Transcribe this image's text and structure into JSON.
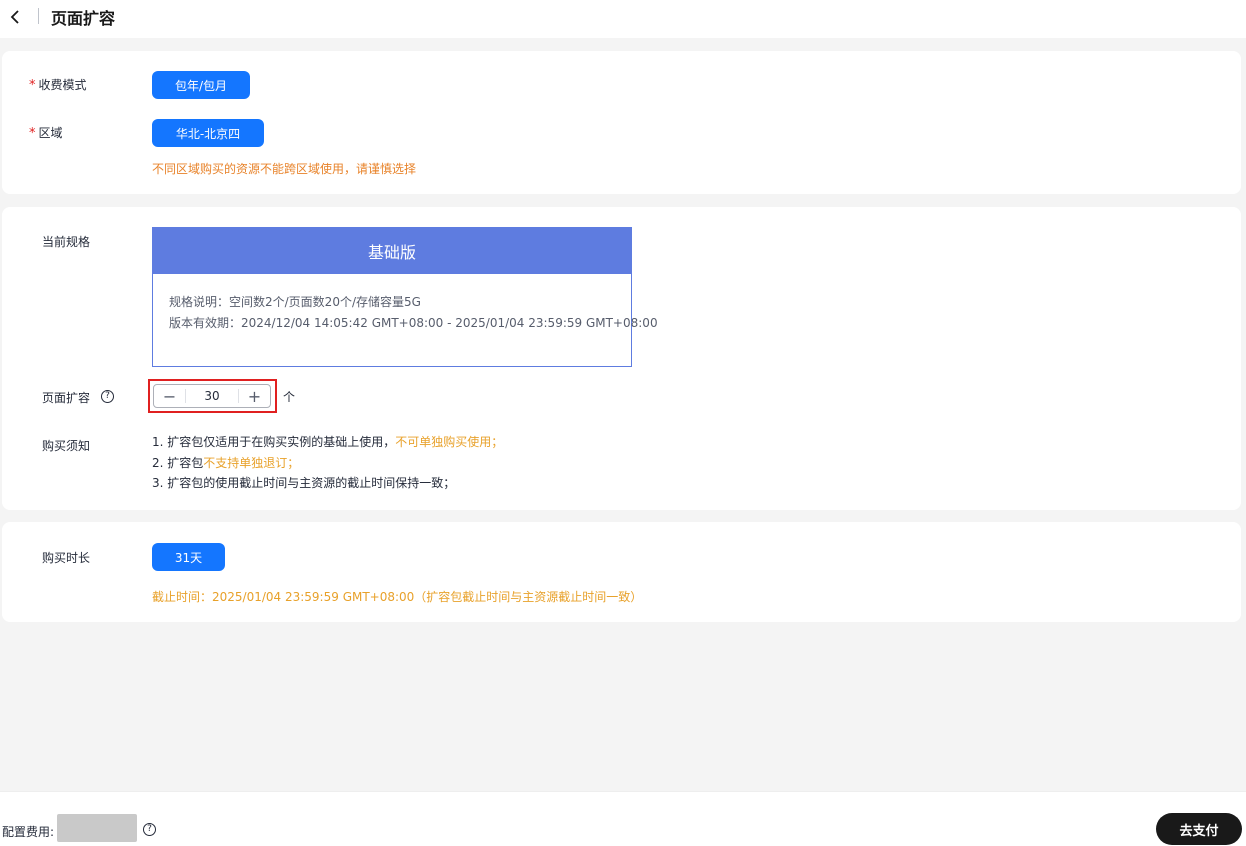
{
  "header": {
    "title": "页面扩容"
  },
  "billing": {
    "label": "收费模式",
    "required_mark": "*",
    "option": "包年/包月"
  },
  "region": {
    "label": "区域",
    "required_mark": "*",
    "option": "华北-北京四",
    "tip": "不同区域购买的资源不能跨区域使用，请谨慎选择"
  },
  "spec": {
    "label": "当前规格",
    "edition": "基础版",
    "desc": "规格说明：空间数2个/页面数20个/存储容量5G",
    "validity": "版本有效期：2024/12/04 14:05:42 GMT+08:00 - 2025/01/04 23:59:59 GMT+08:00"
  },
  "expansion": {
    "label": "页面扩容",
    "help_glyph": "?",
    "value": "30",
    "unit": "个",
    "minus": "−",
    "plus": "+"
  },
  "notice": {
    "label": "购买须知",
    "line1_text": "1. 扩容包仅适用于在购买实例的基础上使用，",
    "line1_highlight": "不可单独购买使用；",
    "line2_text": "2. 扩容包",
    "line2_highlight": "不支持单独退订；",
    "line3_text": "3. 扩容包的使用截止时间与主资源的截止时间保持一致；"
  },
  "duration": {
    "label": "购买时长",
    "option": "31天",
    "end_time": "截止时间：2025/01/04 23:59:59 GMT+08:00（扩容包截止时间与主资源截止时间一致）"
  },
  "footer": {
    "fee_label": "配置费用:",
    "help_glyph": "?",
    "pay_button": "去支付"
  },
  "colors": {
    "primary": "#1476ff",
    "spec_header": "#5e7ce0",
    "warning": "#e8832a",
    "highlight": "#e8a12a",
    "required": "#e02020",
    "pay_button": "#191919"
  },
  "icons": {
    "back": "chevron-left-icon",
    "help": "question-circle-icon"
  }
}
